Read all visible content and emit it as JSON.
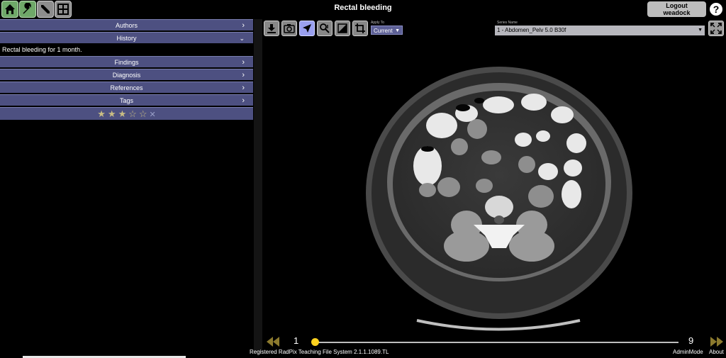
{
  "header": {
    "title": "Rectal bleeding",
    "logout_line1": "Logout",
    "logout_line2": "weadock",
    "help_label": "?"
  },
  "toolbar_icons": [
    "home-icon",
    "wrench-icon",
    "annotate-icon",
    "grid-icon"
  ],
  "sidebar": {
    "sections": [
      {
        "label": "Authors",
        "expanded": false
      },
      {
        "label": "History",
        "expanded": true,
        "content": "Rectal bleeding for 1 month."
      },
      {
        "label": "Findings",
        "expanded": false
      },
      {
        "label": "Diagnosis",
        "expanded": false
      },
      {
        "label": "References",
        "expanded": false
      },
      {
        "label": "Tags",
        "expanded": false
      }
    ],
    "rating": {
      "filled": 3,
      "total": 5,
      "clear_label": "✕"
    }
  },
  "viewer": {
    "tools": [
      "download-icon",
      "camera-icon",
      "pointer-icon",
      "zoom-icon",
      "window-level-icon",
      "crop-icon"
    ],
    "active_tool": "pointer-icon",
    "apply_to_label": "Apply To",
    "apply_to_value": "Current",
    "series_label": "Series Name",
    "series_value": "1 - Abdomen_Pelv 5.0 B30f"
  },
  "slider": {
    "min": "1",
    "max": "9",
    "current": 1
  },
  "footer": {
    "system_text": "Registered RadPix Teaching File System 2.1.1.1089.TL",
    "admin_mode": "AdminMode",
    "about": "About"
  },
  "colors": {
    "accordion": "#4d5081",
    "accent_green": "#6fa869",
    "slider_thumb": "#ffd21f",
    "nav_arrow": "#8c7a2e"
  }
}
